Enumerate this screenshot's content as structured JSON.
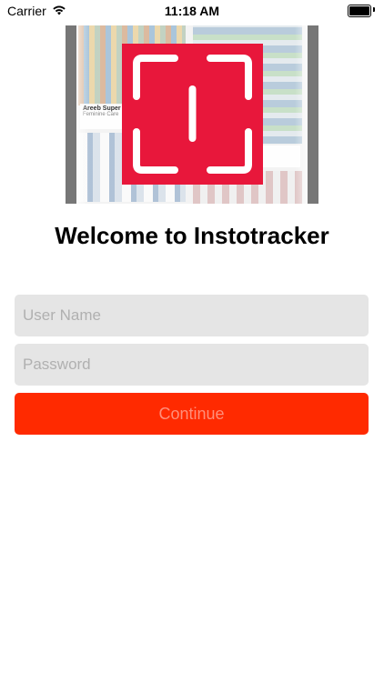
{
  "status_bar": {
    "carrier": "Carrier",
    "time": "11:18 AM",
    "icons": [
      "wifi-icon",
      "battery-icon"
    ]
  },
  "hero": {
    "caption_title": "Areeb Super",
    "caption_subtitle": "Feminine Care"
  },
  "logo": {
    "color": "#e8173b",
    "icon": "scan-frame-icon"
  },
  "title": "Welcome to Instotracker",
  "form": {
    "username_placeholder": "User Name",
    "username_value": "",
    "password_placeholder": "Password",
    "password_value": "",
    "continue_label": "Continue"
  },
  "colors": {
    "accent": "#ff2a00",
    "field_background": "#e5e5e5",
    "placeholder": "#b0b0b0"
  }
}
